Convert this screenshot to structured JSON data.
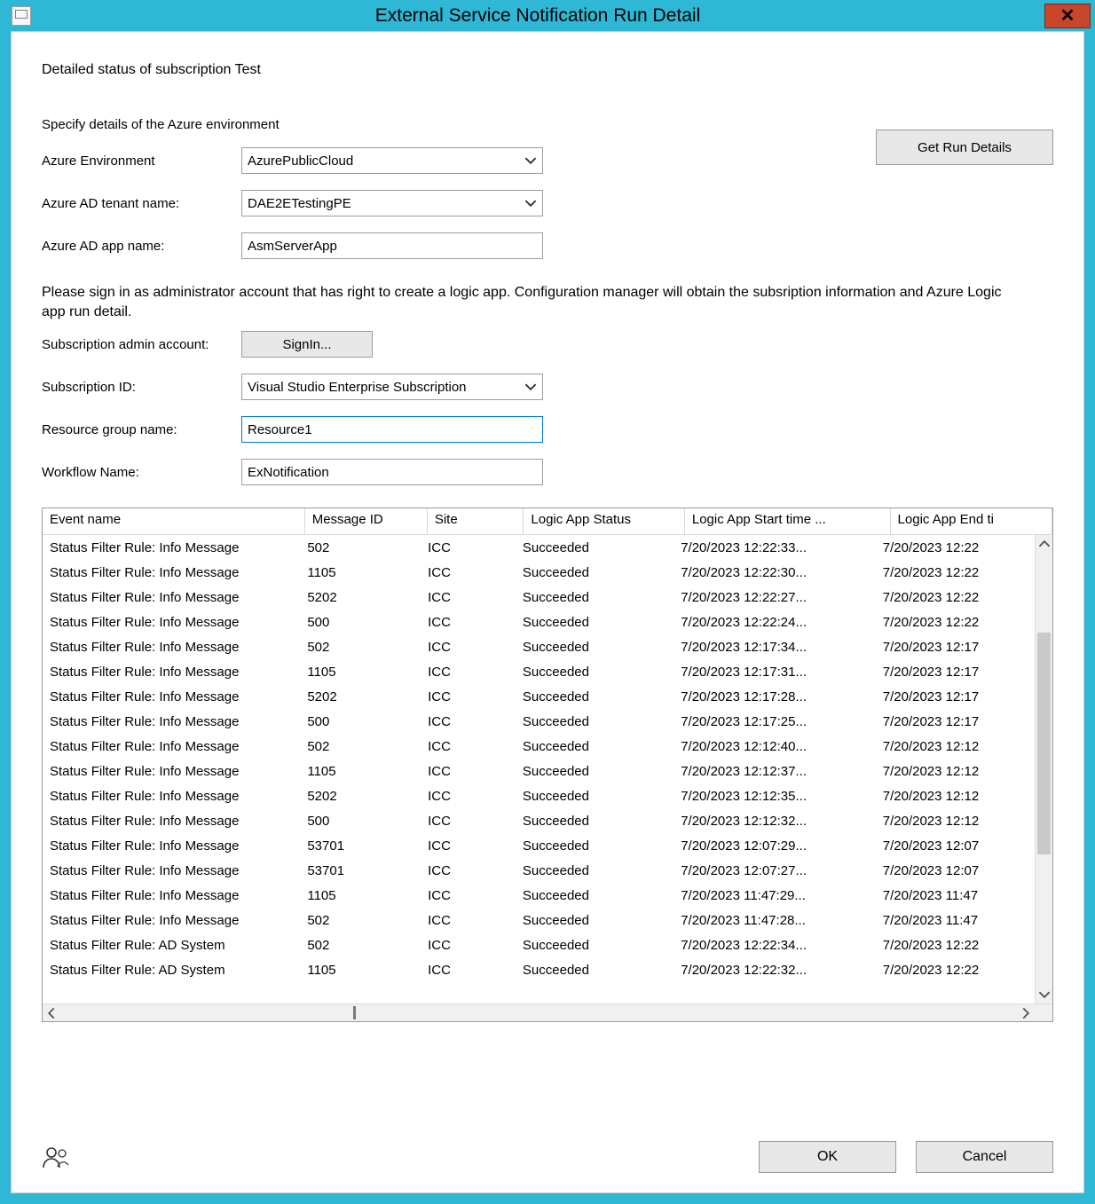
{
  "titlebar": {
    "title": "External Service Notification Run Detail",
    "close_glyph": "✕"
  },
  "main": {
    "status_line": "Detailed status of subscription Test",
    "specify_line": "Specify details of the Azure environment",
    "get_run_details": "Get Run Details",
    "labels": {
      "azure_env": "Azure Environment",
      "tenant": "Azure AD tenant name:",
      "app": "Azure AD app name:",
      "admin_account": "Subscription admin account:",
      "sub_id": "Subscription ID:",
      "rg": "Resource group name:",
      "workflow": "Workflow Name:"
    },
    "values": {
      "azure_env": "AzurePublicCloud",
      "tenant": "DAE2ETestingPE",
      "app": "AsmServerApp",
      "sub_id": "Visual Studio Enterprise Subscription",
      "rg": "Resource1",
      "workflow": "ExNotification"
    },
    "instruction": "Please sign in as administrator account that has right to create a logic app. Configuration manager will obtain the subsription information and Azure Logic app run detail.",
    "signin_label": "SignIn..."
  },
  "table": {
    "columns": [
      "Event name",
      "Message ID",
      "Site",
      "Logic App Status",
      "Logic App Start time ...",
      "Logic App End ti"
    ],
    "rows": [
      [
        "Status Filter Rule: Info Message",
        "502",
        "ICC",
        "Succeeded",
        "7/20/2023 12:22:33...",
        "7/20/2023 12:22"
      ],
      [
        "Status Filter Rule: Info Message",
        "1105",
        "ICC",
        "Succeeded",
        "7/20/2023 12:22:30...",
        "7/20/2023 12:22"
      ],
      [
        "Status Filter Rule: Info Message",
        "5202",
        "ICC",
        "Succeeded",
        "7/20/2023 12:22:27...",
        "7/20/2023 12:22"
      ],
      [
        "Status Filter Rule: Info Message",
        "500",
        "ICC",
        "Succeeded",
        "7/20/2023 12:22:24...",
        "7/20/2023 12:22"
      ],
      [
        "Status Filter Rule: Info Message",
        "502",
        "ICC",
        "Succeeded",
        "7/20/2023 12:17:34...",
        "7/20/2023 12:17"
      ],
      [
        "Status Filter Rule: Info Message",
        "1105",
        "ICC",
        "Succeeded",
        "7/20/2023 12:17:31...",
        "7/20/2023 12:17"
      ],
      [
        "Status Filter Rule: Info Message",
        "5202",
        "ICC",
        "Succeeded",
        "7/20/2023 12:17:28...",
        "7/20/2023 12:17"
      ],
      [
        "Status Filter Rule: Info Message",
        "500",
        "ICC",
        "Succeeded",
        "7/20/2023 12:17:25...",
        "7/20/2023 12:17"
      ],
      [
        "Status Filter Rule: Info Message",
        "502",
        "ICC",
        "Succeeded",
        "7/20/2023 12:12:40...",
        "7/20/2023 12:12"
      ],
      [
        "Status Filter Rule: Info Message",
        "1105",
        "ICC",
        "Succeeded",
        "7/20/2023 12:12:37...",
        "7/20/2023 12:12"
      ],
      [
        "Status Filter Rule: Info Message",
        "5202",
        "ICC",
        "Succeeded",
        "7/20/2023 12:12:35...",
        "7/20/2023 12:12"
      ],
      [
        "Status Filter Rule: Info Message",
        "500",
        "ICC",
        "Succeeded",
        "7/20/2023 12:12:32...",
        "7/20/2023 12:12"
      ],
      [
        "Status Filter Rule: Info Message",
        "53701",
        "ICC",
        "Succeeded",
        "7/20/2023 12:07:29...",
        "7/20/2023 12:07"
      ],
      [
        "Status Filter Rule: Info Message",
        "53701",
        "ICC",
        "Succeeded",
        "7/20/2023 12:07:27...",
        "7/20/2023 12:07"
      ],
      [
        "Status Filter Rule: Info Message",
        "1105",
        "ICC",
        "Succeeded",
        "7/20/2023 11:47:29...",
        "7/20/2023 11:47"
      ],
      [
        "Status Filter Rule: Info Message",
        "502",
        "ICC",
        "Succeeded",
        "7/20/2023 11:47:28...",
        "7/20/2023 11:47"
      ],
      [
        "Status Filter Rule: AD System",
        "502",
        "ICC",
        "Succeeded",
        "7/20/2023 12:22:34...",
        "7/20/2023 12:22"
      ],
      [
        "Status Filter Rule: AD System",
        "1105",
        "ICC",
        "Succeeded",
        "7/20/2023 12:22:32...",
        "7/20/2023 12:22"
      ]
    ]
  },
  "footer": {
    "ok": "OK",
    "cancel": "Cancel"
  }
}
